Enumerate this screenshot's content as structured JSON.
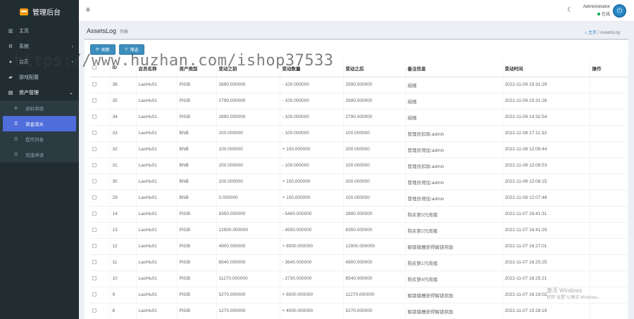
{
  "app": {
    "title": "管理后台"
  },
  "sidebar": {
    "items": [
      {
        "label": "主页",
        "icon": "dashboard-icon",
        "has_arrow": false
      },
      {
        "label": "系统",
        "icon": "gear-icon",
        "has_arrow": true
      },
      {
        "label": "会员",
        "icon": "user-icon",
        "has_arrow": true
      },
      {
        "label": "游戏配置",
        "icon": "gamepad-icon",
        "has_arrow": false
      },
      {
        "label": "资产管理",
        "icon": "wallet-icon",
        "has_arrow": true
      }
    ],
    "subitems": [
      {
        "label": "资料审核",
        "icon": "gear-icon",
        "active": false
      },
      {
        "label": "资金流水",
        "icon": "list-icon",
        "active": true
      },
      {
        "label": "提币列表",
        "icon": "list-icon",
        "active": false
      },
      {
        "label": "充值申请",
        "icon": "list-icon",
        "active": false
      }
    ]
  },
  "header": {
    "user_name": "Administrator",
    "user_status": "在线"
  },
  "page": {
    "title": "AssetsLog",
    "subtitle": "列表",
    "breadcrumb_home": "主页",
    "breadcrumb_sep": "/",
    "breadcrumb_current": "AssetsLog"
  },
  "toolbar": {
    "refresh_label": "刷新",
    "filter_label": "筛选"
  },
  "table": {
    "columns": [
      "",
      "ID",
      "会员名称",
      "资产类型",
      "变动之前",
      "变动数量",
      "变动之后",
      "备注信息",
      "变动时间",
      "操作"
    ],
    "rows": [
      [
        "36",
        "LaoHu01",
        "PIGB",
        "2690.000000",
        "- 100.000000",
        "2590.000000",
        "捐赠",
        "2022-11-09 15:31:29"
      ],
      [
        "35",
        "LaoHu01",
        "PIGB",
        "2790.000000",
        "- 100.000000",
        "2690.000000",
        "捐赠",
        "2022-11-09 15:31:26"
      ],
      [
        "34",
        "LaoHu01",
        "PIGB",
        "2890.000000",
        "- 100.000000",
        "2790.000000",
        "捐赠",
        "2022-11-09 14:32:54"
      ],
      [
        "33",
        "LaoHu01",
        "BNB",
        "200.000000",
        "- 100.000000",
        "100.000000",
        "管理员扣除:admin",
        "2022-11-08 17:11:33"
      ],
      [
        "32",
        "LaoHu01",
        "BNB",
        "100.000000",
        "+ 100.000000",
        "200.000000",
        "管理员增加:admin",
        "2022-11-08 12:09:44"
      ],
      [
        "31",
        "LaoHu01",
        "BNB",
        "200.000000",
        "- 100.000000",
        "100.000000",
        "管理员扣除:admin",
        "2022-11-08 12:08:53"
      ],
      [
        "30",
        "LaoHu01",
        "BNB",
        "100.000000",
        "+ 100.000000",
        "200.000000",
        "管理员增加:admin",
        "2022-11-08 12:08:15"
      ],
      [
        "29",
        "LaoHu01",
        "BNB",
        "0.000000",
        "+ 100.000000",
        "100.000000",
        "管理员增加:admin",
        "2022-11-08 12:07:48"
      ],
      [
        "14",
        "LaoHu01",
        "PIGB",
        "8350.000000",
        "- 5460.000000",
        "2890.000000",
        "购买第3只肉猪",
        "2022-11-07 16:41:31"
      ],
      [
        "13",
        "LaoHu01",
        "PIGB",
        "12900.000000",
        "- 4550.000000",
        "8350.000000",
        "购买第2只肉猪",
        "2022-11-07 16:41:29"
      ],
      [
        "12",
        "LaoHu01",
        "PIGB",
        "4900.000000",
        "+ 8000.000000",
        "12900.000000",
        "解锁猪槽获得解锁奖励",
        "2022-11-07 16:27:01"
      ],
      [
        "11",
        "LaoHu01",
        "PIGB",
        "8540.000000",
        "- 3640.000000",
        "4900.000000",
        "购买第1只肉猪",
        "2022-11-07 16:25:25"
      ],
      [
        "10",
        "LaoHu01",
        "PIGB",
        "11270.000000",
        "- 2730.000000",
        "8540.000000",
        "购买第4只肉猪",
        "2022-11-07 16:25:21"
      ],
      [
        "9",
        "LaoHu01",
        "PIGB",
        "5270.000000",
        "+ 6000.000000",
        "11270.000000",
        "解锁猪槽获得解锁奖励",
        "2022-11-07 16:19:02"
      ],
      [
        "8",
        "LaoHu01",
        "PIGB",
        "1270.000000",
        "+ 4000.000000",
        "5270.000000",
        "解锁猪槽获得解锁奖励",
        "2022-11-07 15:28:19"
      ]
    ]
  },
  "watermark": "https://www.huzhan.com/ishop37533",
  "windows_notice": {
    "line1": "激活 Windows",
    "line2": "转到\"设置\"以激活 Windows。"
  },
  "colors": {
    "sidebar_bg": "#222d32",
    "accent": "#3c8dbc",
    "active_item": "#4f6ddb",
    "online": "#00a65a"
  }
}
